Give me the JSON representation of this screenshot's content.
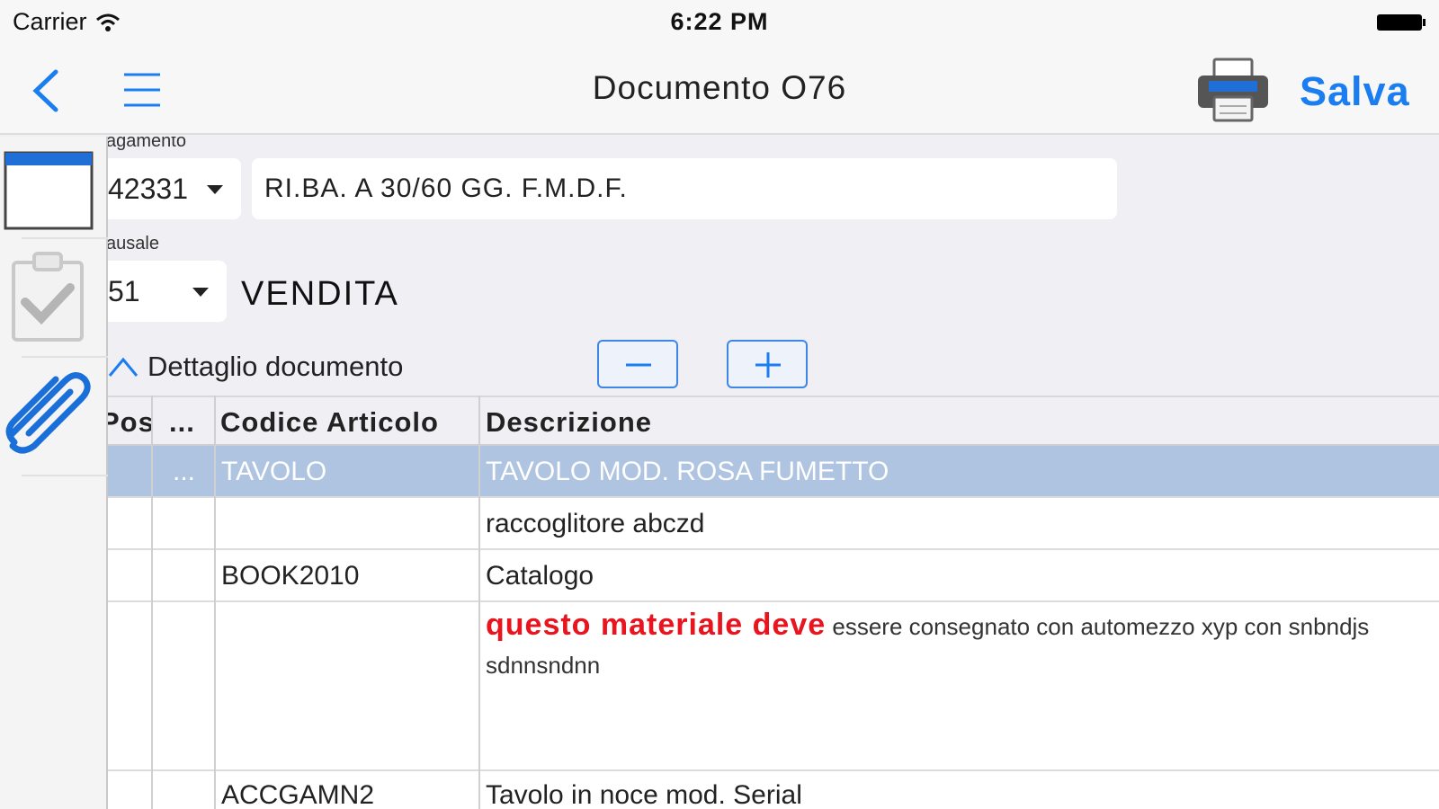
{
  "status": {
    "carrier": "Carrier",
    "time": "6:22 PM"
  },
  "nav": {
    "title": "Documento O76",
    "save_label": "Salva"
  },
  "payment": {
    "label": "agamento",
    "code": "42331",
    "description": "RI.BA. A 30/60 GG. F.M.D.F."
  },
  "causale": {
    "label": "ausale",
    "code": "51",
    "text": "VENDITA"
  },
  "detail": {
    "header": "Dettaglio documento",
    "minus": "−",
    "plus": "+"
  },
  "table": {
    "headers": {
      "pos": "Pos",
      "dots": "...",
      "code": "Codice Articolo",
      "desc": "Descrizione"
    },
    "rows": [
      {
        "dots": "...",
        "code": "TAVOLO",
        "desc": "TAVOLO MOD. ROSA FUMETTO"
      },
      {
        "code": "",
        "desc": "raccoglitore abczd"
      },
      {
        "code": "BOOK2010",
        "desc": "Catalogo"
      },
      {
        "code": "",
        "desc_red": "questo materiale deve",
        "desc_rest": " essere consegnato con automezzo xyp con snbndjs sdnnsndnn"
      },
      {
        "code": "ACCGAMN2",
        "desc": "Tavolo in noce mod. Serial"
      }
    ]
  },
  "colors": {
    "accent": "#1a7df0",
    "selected_row": "#aec4e0",
    "alert": "#e8141e"
  }
}
